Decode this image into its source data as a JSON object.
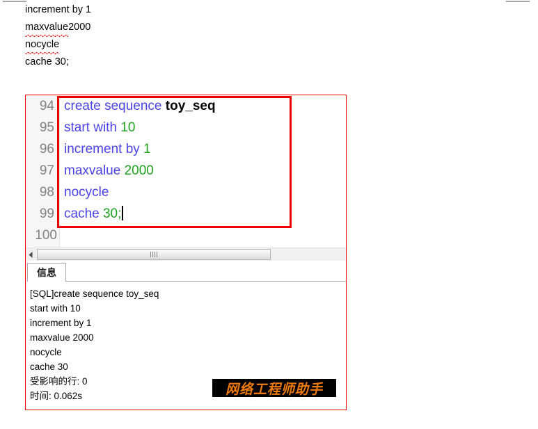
{
  "document_text": {
    "lines": [
      {
        "segments": [
          {
            "text": "increment by 1",
            "misspelled": false
          }
        ]
      },
      {
        "segments": [
          {
            "text": "maxvalue",
            "misspelled": true
          },
          {
            "text": " 2000",
            "misspelled": false
          }
        ]
      },
      {
        "segments": [
          {
            "text": "nocycle",
            "misspelled": true
          }
        ]
      },
      {
        "segments": [
          {
            "text": "cache 30;",
            "misspelled": false
          }
        ]
      }
    ]
  },
  "editor": {
    "line_numbers": [
      "94",
      "95",
      "96",
      "97",
      "98",
      "99",
      "100"
    ],
    "lines": [
      {
        "tokens": [
          {
            "text": "create sequence ",
            "type": "keyword"
          },
          {
            "text": "toy_seq",
            "type": "identifier"
          }
        ]
      },
      {
        "tokens": [
          {
            "text": "start with ",
            "type": "keyword"
          },
          {
            "text": "10",
            "type": "number"
          }
        ]
      },
      {
        "tokens": [
          {
            "text": "increment by ",
            "type": "keyword"
          },
          {
            "text": "1",
            "type": "number"
          }
        ]
      },
      {
        "tokens": [
          {
            "text": "maxvalue ",
            "type": "keyword"
          },
          {
            "text": "2000",
            "type": "number"
          }
        ]
      },
      {
        "tokens": [
          {
            "text": "nocycle",
            "type": "keyword"
          }
        ]
      },
      {
        "tokens": [
          {
            "text": "cache ",
            "type": "keyword"
          },
          {
            "text": "30",
            "type": "number"
          },
          {
            "text": ";",
            "type": "number"
          }
        ]
      }
    ],
    "caret_on_line": 5,
    "colors": {
      "keyword": "#4a43e8",
      "number": "#1fa01f",
      "identifier": "#000000",
      "line_number": "#808080",
      "gutter_background": "#f6f6f6"
    }
  },
  "scrollbar": {
    "left_arrow_icon": "triangle-left-icon",
    "grip_icon": "scrollbar-grip-icon"
  },
  "tabs": [
    {
      "label": "信息",
      "active": true
    }
  ],
  "output": {
    "lines": [
      "[SQL]create sequence toy_seq",
      "start with 10",
      "increment by 1",
      "maxvalue 2000",
      "nocycle",
      "cache 30",
      "受影响的行: 0",
      "时间: 0.062s"
    ]
  },
  "watermark": {
    "text": "网络工程师助手",
    "text_color": "#ef7a10",
    "background_color": "#000000"
  },
  "annotations": {
    "outer_box_color": "#ee0000",
    "inner_box_color": "#ee0000"
  }
}
